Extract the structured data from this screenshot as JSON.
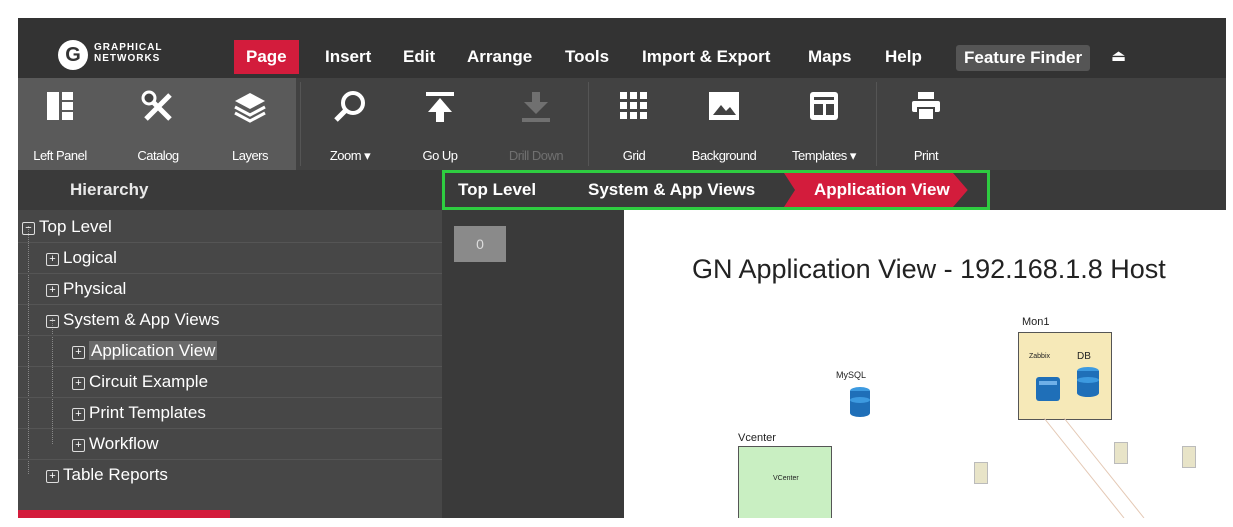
{
  "logo": {
    "mark": "G",
    "line1": "GRAPHICAL",
    "line2": "NETWORKS"
  },
  "menu": {
    "items": [
      "Page",
      "Insert",
      "Edit",
      "Arrange",
      "Tools",
      "Import & Export",
      "Maps",
      "Help"
    ],
    "active": "Page",
    "feature_finder": "Feature Finder"
  },
  "toolbar": {
    "left_panel": "Left Panel",
    "catalog": "Catalog",
    "layers": "Layers",
    "zoom": "Zoom ▾",
    "go_up": "Go Up",
    "drill_down": "Drill Down",
    "grid": "Grid",
    "background": "Background",
    "templates": "Templates ▾",
    "print": "Print"
  },
  "hierarchy": {
    "title": "Hierarchy",
    "nodes": [
      {
        "label": "Top Level",
        "toggle": "−"
      },
      {
        "label": "Logical",
        "toggle": "+"
      },
      {
        "label": "Physical",
        "toggle": "+"
      },
      {
        "label": "System & App Views",
        "toggle": "−"
      },
      {
        "label": "Application View",
        "toggle": "+"
      },
      {
        "label": "Circuit Example",
        "toggle": "+"
      },
      {
        "label": "Print Templates",
        "toggle": "+"
      },
      {
        "label": "Workflow",
        "toggle": "+"
      },
      {
        "label": "Table Reports",
        "toggle": "+"
      }
    ]
  },
  "breadcrumb": [
    "Top Level",
    "System & App Views",
    "Application View"
  ],
  "counter": "0",
  "canvas": {
    "title": "GN Application View - 192.168.1.8 Host",
    "groups": {
      "mon1": "Mon1",
      "vcenter": "Vcenter"
    },
    "nodes": {
      "mysql": "MySQL",
      "db": "DB",
      "zabbix": "Zabbix",
      "vcenter_node": "VCenter"
    }
  },
  "colors": {
    "accent": "#d31c3c",
    "highlight": "#2ecc40",
    "menubar": "#333333",
    "toolbar": "#424242"
  }
}
